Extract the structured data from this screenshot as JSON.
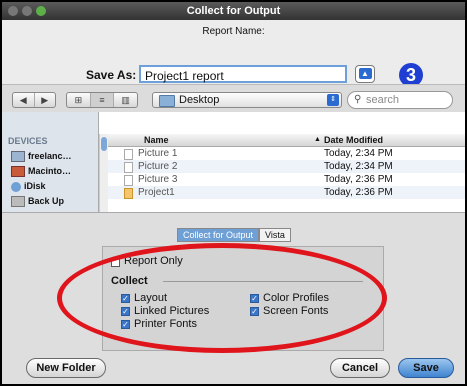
{
  "window": {
    "title": "Collect for Output"
  },
  "header": {
    "report_name_label": "Report Name:",
    "save_as_label": "Save As:",
    "save_as_value": "Project1 report",
    "expand_glyph": "▲",
    "step_badge": "3"
  },
  "toolbar": {
    "back_glyph": "◀",
    "forward_glyph": "▶",
    "view_icons": "⊞",
    "view_list": "≡",
    "view_columns": "▥",
    "location": "Desktop",
    "location_arrows": "⇕",
    "search_placeholder": "search"
  },
  "sidebar": {
    "section": "DEVICES",
    "items": [
      {
        "label": "freelanc…",
        "icon": "computer-icon"
      },
      {
        "label": "Macinto…",
        "icon": "hard-drive-icon"
      },
      {
        "label": "iDisk",
        "icon": "idisk-icon"
      },
      {
        "label": "Back Up",
        "icon": "disk-icon"
      }
    ]
  },
  "files": {
    "columns": [
      "Name",
      "Date Modified"
    ],
    "sort_glyph": "▲",
    "rows": [
      {
        "name": "Picture 1",
        "date": "Today, 2:34 PM"
      },
      {
        "name": "Picture 2",
        "date": "Today, 2:34 PM"
      },
      {
        "name": "Picture 3",
        "date": "Today, 2:36 PM"
      },
      {
        "name": "Project1",
        "date": "Today, 2:36 PM"
      }
    ]
  },
  "tabs": [
    {
      "label": "Collect for Output",
      "active": true
    },
    {
      "label": "Vista",
      "active": false
    }
  ],
  "options": {
    "report_only": {
      "label": "Report Only",
      "checked": false
    },
    "collect_heading": "Collect",
    "check_glyph": "✓",
    "items": [
      {
        "label": "Layout",
        "checked": true
      },
      {
        "label": "Linked Pictures",
        "checked": true
      },
      {
        "label": "Printer Fonts",
        "checked": true
      },
      {
        "label": "Color Profiles",
        "checked": true
      },
      {
        "label": "Screen Fonts",
        "checked": true
      }
    ]
  },
  "buttons": {
    "new_folder": "New Folder",
    "cancel": "Cancel",
    "save": "Save"
  },
  "colors": {
    "accent": "#3f84d0",
    "badge": "#1e3fd1",
    "annotation": "#e0141b",
    "titlebar": "#444444"
  }
}
